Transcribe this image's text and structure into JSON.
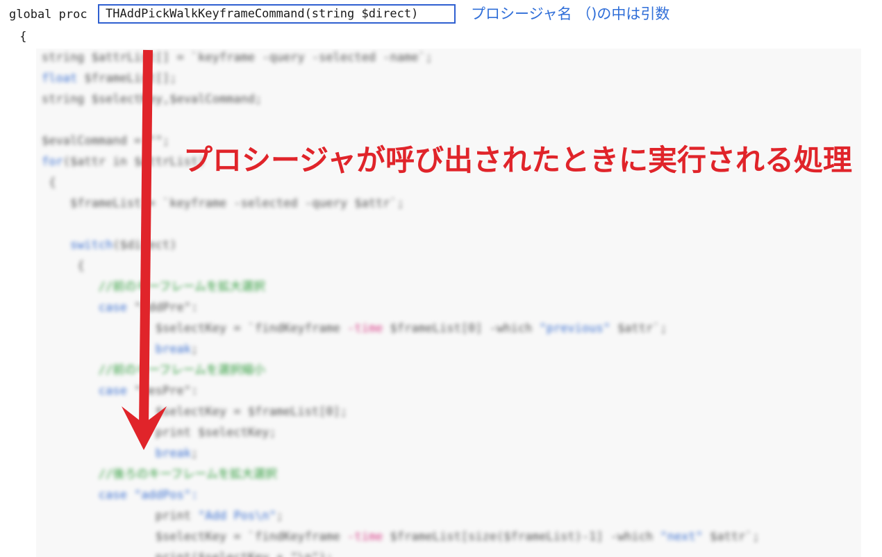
{
  "code_header": {
    "line1_prefix": "global proc",
    "signature": "THAddPickWalkKeyframeCommand(string $direct)",
    "line2": " {"
  },
  "annotations": {
    "signature_note": "プロシージャ名 （)の中は引数",
    "body_note": "プロシージャが呼び出されたときに実行される処理"
  },
  "blurred_code_lines": [
    {
      "indent": "",
      "parts": [
        {
          "t": "string $attrList[] = `keyframe -query -selected -name`;",
          "c": ""
        }
      ]
    },
    {
      "indent": "",
      "parts": [
        {
          "t": "float",
          "c": "k"
        },
        {
          "t": " $frameList[];",
          "c": ""
        }
      ]
    },
    {
      "indent": "",
      "parts": [
        {
          "t": "string $selectKey,$evalCommand;",
          "c": ""
        }
      ]
    },
    {
      "indent": "",
      "parts": []
    },
    {
      "indent": "",
      "parts": [
        {
          "t": "$evalCommand = \"\";",
          "c": ""
        }
      ]
    },
    {
      "indent": "",
      "parts": [
        {
          "t": "for",
          "c": "k"
        },
        {
          "t": "($attr in $attrList)",
          "c": ""
        }
      ]
    },
    {
      "indent": " ",
      "parts": [
        {
          "t": "{",
          "c": ""
        }
      ]
    },
    {
      "indent": "    ",
      "parts": [
        {
          "t": "$frameList = `keyframe -selected -query $attr`;",
          "c": ""
        }
      ]
    },
    {
      "indent": "",
      "parts": []
    },
    {
      "indent": "    ",
      "parts": [
        {
          "t": "switch",
          "c": "k"
        },
        {
          "t": "($direct)",
          "c": ""
        }
      ]
    },
    {
      "indent": "     ",
      "parts": [
        {
          "t": "{",
          "c": ""
        }
      ]
    },
    {
      "indent": "        ",
      "parts": [
        {
          "t": "//前のキーフレームを拡大選択",
          "c": "c"
        }
      ]
    },
    {
      "indent": "        ",
      "parts": [
        {
          "t": "case",
          "c": "k"
        },
        {
          "t": " \"addPre\":",
          "c": ""
        }
      ]
    },
    {
      "indent": "                ",
      "parts": [
        {
          "t": "$selectKey = `findKeyframe ",
          "c": ""
        },
        {
          "t": "-time",
          "c": "m"
        },
        {
          "t": " $frameList[0] -which ",
          "c": ""
        },
        {
          "t": "\"previous\"",
          "c": "s"
        },
        {
          "t": " $attr`;",
          "c": ""
        }
      ]
    },
    {
      "indent": "                ",
      "parts": [
        {
          "t": "break",
          "c": "k"
        },
        {
          "t": ";",
          "c": ""
        }
      ]
    },
    {
      "indent": "        ",
      "parts": [
        {
          "t": "//前のキーフレームを選択縮小",
          "c": "c"
        }
      ]
    },
    {
      "indent": "        ",
      "parts": [
        {
          "t": "case",
          "c": "k"
        },
        {
          "t": " \"desPre\":",
          "c": ""
        }
      ]
    },
    {
      "indent": "                ",
      "parts": [
        {
          "t": "$selectKey = $frameList[0];",
          "c": ""
        }
      ]
    },
    {
      "indent": "                ",
      "parts": [
        {
          "t": "print $selectKey;",
          "c": ""
        }
      ]
    },
    {
      "indent": "                ",
      "parts": [
        {
          "t": "break",
          "c": "k"
        },
        {
          "t": ";",
          "c": ""
        }
      ]
    },
    {
      "indent": "        ",
      "parts": [
        {
          "t": "//後ろのキーフレームを拡大選択",
          "c": "c"
        }
      ]
    },
    {
      "indent": "        ",
      "parts": [
        {
          "t": "case",
          "c": "k"
        },
        {
          "t": " \"addPos\":",
          "c": "s"
        }
      ]
    },
    {
      "indent": "                ",
      "parts": [
        {
          "t": "print ",
          "c": ""
        },
        {
          "t": "\"Add Pos\\n\"",
          "c": "s"
        },
        {
          "t": ";",
          "c": ""
        }
      ]
    },
    {
      "indent": "                ",
      "parts": [
        {
          "t": "$selectKey = `findKeyframe ",
          "c": ""
        },
        {
          "t": "-time",
          "c": "m"
        },
        {
          "t": " $frameList[size($frameList)-1] -which ",
          "c": ""
        },
        {
          "t": "\"next\"",
          "c": "s"
        },
        {
          "t": " $attr`;",
          "c": ""
        }
      ]
    },
    {
      "indent": "                ",
      "parts": [
        {
          "t": "print($selectKey + \"\\n\");",
          "c": ""
        }
      ]
    }
  ],
  "colors": {
    "signature_box": "#2f5fd0",
    "note_blue": "#2f6ed8",
    "note_red": "#e0242a",
    "arrow_red": "#e0242a"
  }
}
